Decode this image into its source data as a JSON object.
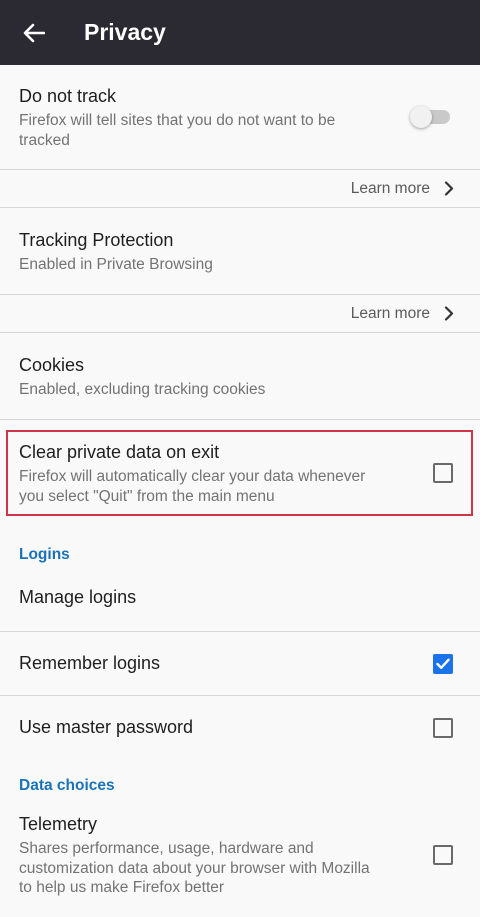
{
  "appbar": {
    "title": "Privacy"
  },
  "do_not_track": {
    "title": "Do not track",
    "summary": "Firefox will tell sites that you do not want to be tracked",
    "enabled": false
  },
  "learn_more_1": {
    "label": "Learn more"
  },
  "tracking_protection": {
    "title": "Tracking Protection",
    "summary": "Enabled in Private Browsing"
  },
  "learn_more_2": {
    "label": "Learn more"
  },
  "cookies": {
    "title": "Cookies",
    "summary": "Enabled, excluding tracking cookies"
  },
  "clear_private_data": {
    "title": "Clear private data on exit",
    "summary": "Firefox will automatically clear your data whenever you select \"Quit\" from the main menu",
    "checked": false
  },
  "logins_section": {
    "title": "Logins"
  },
  "manage_logins": {
    "title": "Manage logins"
  },
  "remember_logins": {
    "title": "Remember logins",
    "checked": true
  },
  "master_password": {
    "title": "Use master password",
    "checked": false
  },
  "data_choices_section": {
    "title": "Data choices"
  },
  "telemetry": {
    "title": "Telemetry",
    "summary": "Shares performance, usage, hardware and customization data about your browser with Mozilla to help us make Firefox better",
    "checked": false
  },
  "colors": {
    "accent": "#1a73e8",
    "highlight": "#d0344a",
    "appbar": "#2b2a33"
  }
}
